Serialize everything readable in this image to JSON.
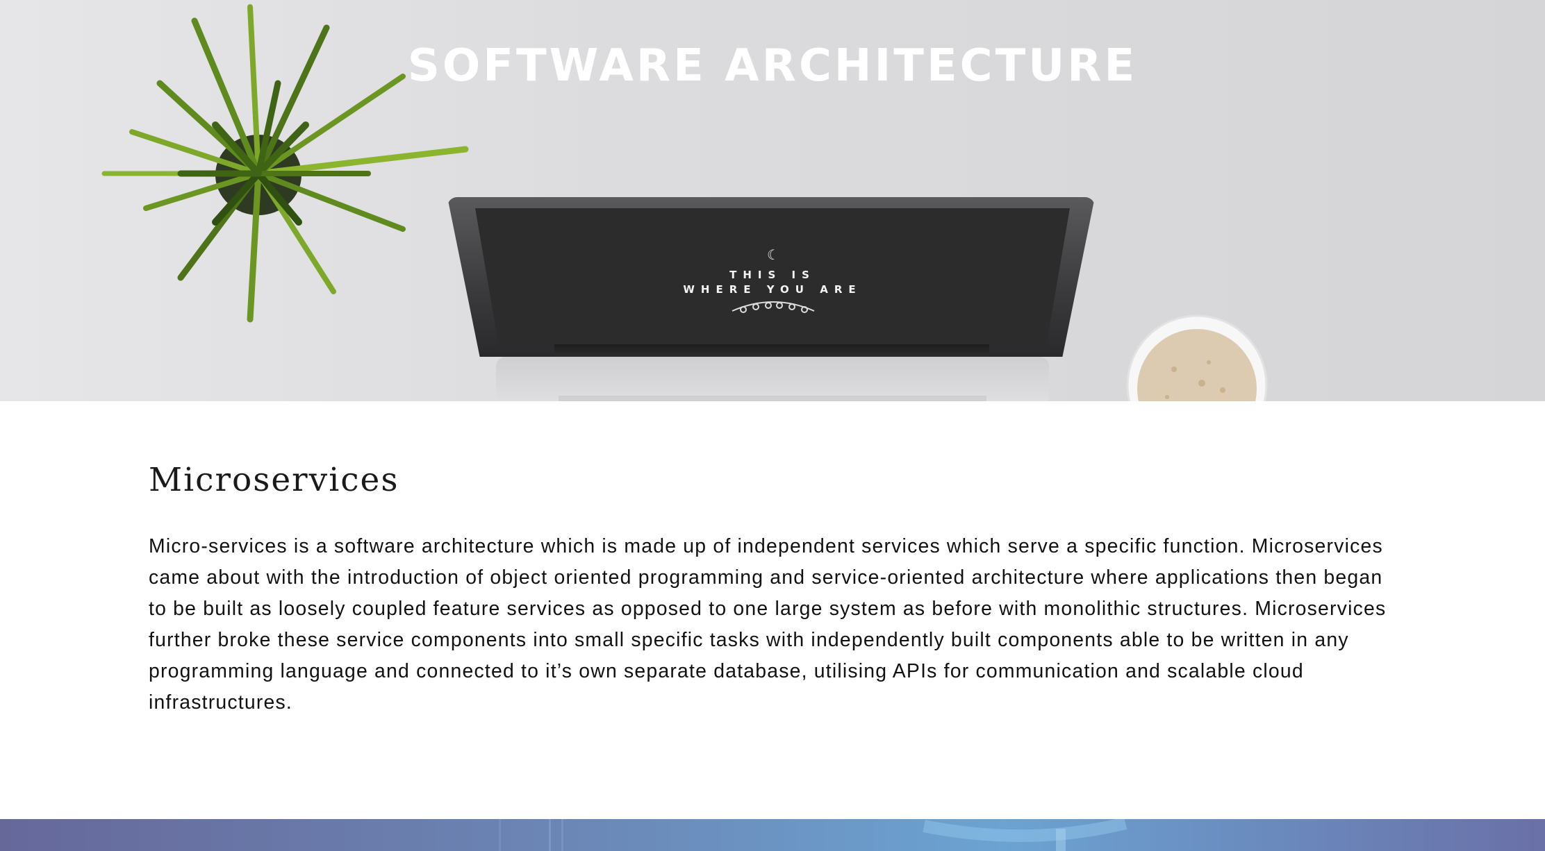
{
  "hero": {
    "title": "SOFTWARE ARCHITECTURE",
    "screen_line1": "THIS IS",
    "screen_line2": "WHERE YOU ARE"
  },
  "section": {
    "title": "Microservices",
    "body": "Micro-services is a software architecture which is made up of independent services which serve a specific function. Microservices came about with the introduction of object oriented programming and service-oriented architecture where applications then began to be built as loosely coupled feature services as opposed to one large system as before with monolithic structures. Microservices further broke these service components into small specific tasks with independently built components able to be written in any programming language and connected to it’s own separate database, utilising APIs for communication and scalable cloud infrastructures."
  },
  "colors": {
    "hero_title": "#ffffff",
    "text": "#111111",
    "footer_left": "#66689a",
    "footer_mid": "#6ba3d2"
  },
  "icons": {
    "screen_moon": "moon-icon",
    "plant": "plant-image",
    "cup": "coffee-cup-image"
  }
}
